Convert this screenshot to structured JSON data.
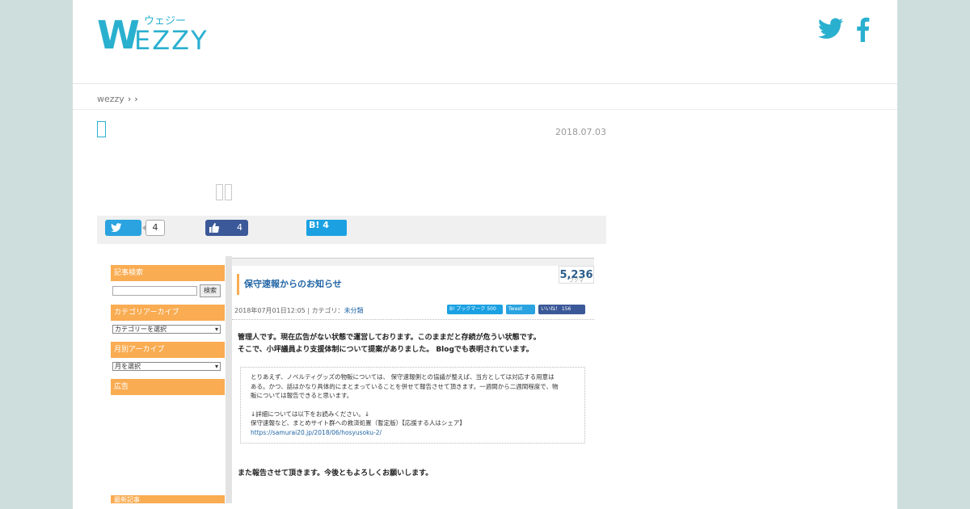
{
  "site": {
    "logo_text": "WEZZY",
    "logo_kana": "ウェジー"
  },
  "social": {
    "twitter_icon": "twitter-icon",
    "facebook_icon": "facebook-icon",
    "color": "#2ab0cf"
  },
  "breadcrumb": {
    "home": "wezzy",
    "sep1": "›",
    "sep2": "›"
  },
  "article": {
    "date": "2018.07.03"
  },
  "share": {
    "twitter_count": "4",
    "facebook_count": "4",
    "hatena_label": "B!",
    "hatena_count": "4"
  },
  "screenshot": {
    "sidebar": {
      "search_heading": "記事検索",
      "search_button": "検索",
      "category_heading": "カテゴリアーカイブ",
      "category_select": "カテゴリーを選択",
      "monthly_heading": "月別アーカイブ",
      "monthly_select": "月を選択",
      "ads_heading": "広告",
      "recent_heading": "最新記事"
    },
    "post": {
      "title": "保守速報からのお知らせ",
      "count": "5,236",
      "count_unit": "ブクマ",
      "meta_date": "2018年07月01日12:05",
      "meta_sep": " | カテゴリ：",
      "meta_category": "未分類",
      "btn_hatena": "B! ブックマーク 500",
      "btn_tweet": "Tweet",
      "btn_like": "いいね！ 156",
      "para1_line1": "管理人です。現在広告がない状態で運営しております。このままだと存続が危うい状態です。",
      "para1_line2": "そこで、小坪議員より支援体制について提案がありました。 Blogでも表明されています。",
      "quote_line1": "とりあえず、ノベルティグッズの物販については、 保守速報側との協議が整えば、当方としては対応する用意は",
      "quote_line2": "ある。かつ、話はかなり具体的にまとまっていることを併せて報告させて頂きます。一週間から二週間程度で、物",
      "quote_line3": "販については報告できると思います。",
      "quote_line4": "↓詳細については以下をお読みください。↓",
      "quote_line5": "保守速報など、まとめサイト群への救済処置（暫定版）【応援する人はシェア】",
      "quote_link": "https://samurai20.jp/2018/06/hosyusoku-2/",
      "para2": "また報告させて頂きます。今後ともよろしくお願いします。"
    }
  }
}
